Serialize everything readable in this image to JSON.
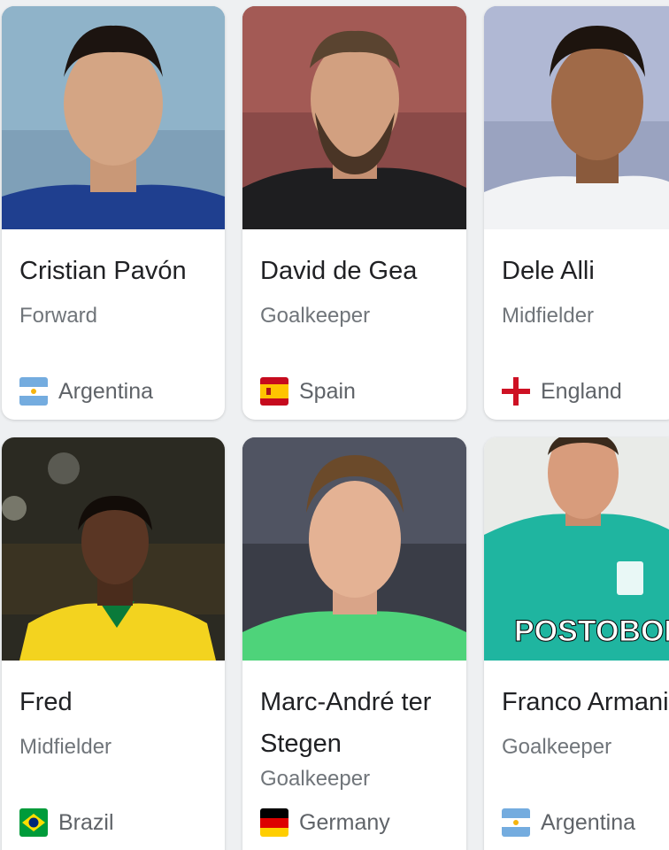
{
  "players": [
    {
      "name": "Cristian Pavón",
      "position": "Forward",
      "country": "Argentina",
      "flag_icon": "argentina-flag-icon"
    },
    {
      "name": "David de Gea",
      "position": "Goalkeeper",
      "country": "Spain",
      "flag_icon": "spain-flag-icon"
    },
    {
      "name": "Dele Alli",
      "position": "Midfielder",
      "country": "England",
      "flag_icon": "england-flag-icon"
    },
    {
      "name": "Fred",
      "position": "Midfielder",
      "country": "Brazil",
      "flag_icon": "brazil-flag-icon"
    },
    {
      "name": "Marc-André ter Stegen",
      "position": "Goalkeeper",
      "country": "Germany",
      "flag_icon": "germany-flag-icon"
    },
    {
      "name": "Franco Armani",
      "position": "Goalkeeper",
      "country": "Argentina",
      "flag_icon": "argentina-flag-icon"
    }
  ],
  "shirt_text": "POSTOBON",
  "colors": {
    "card_background": "#ffffff",
    "page_background": "#eef0f2",
    "name_text": "#202124",
    "secondary_text": "#70757a"
  }
}
